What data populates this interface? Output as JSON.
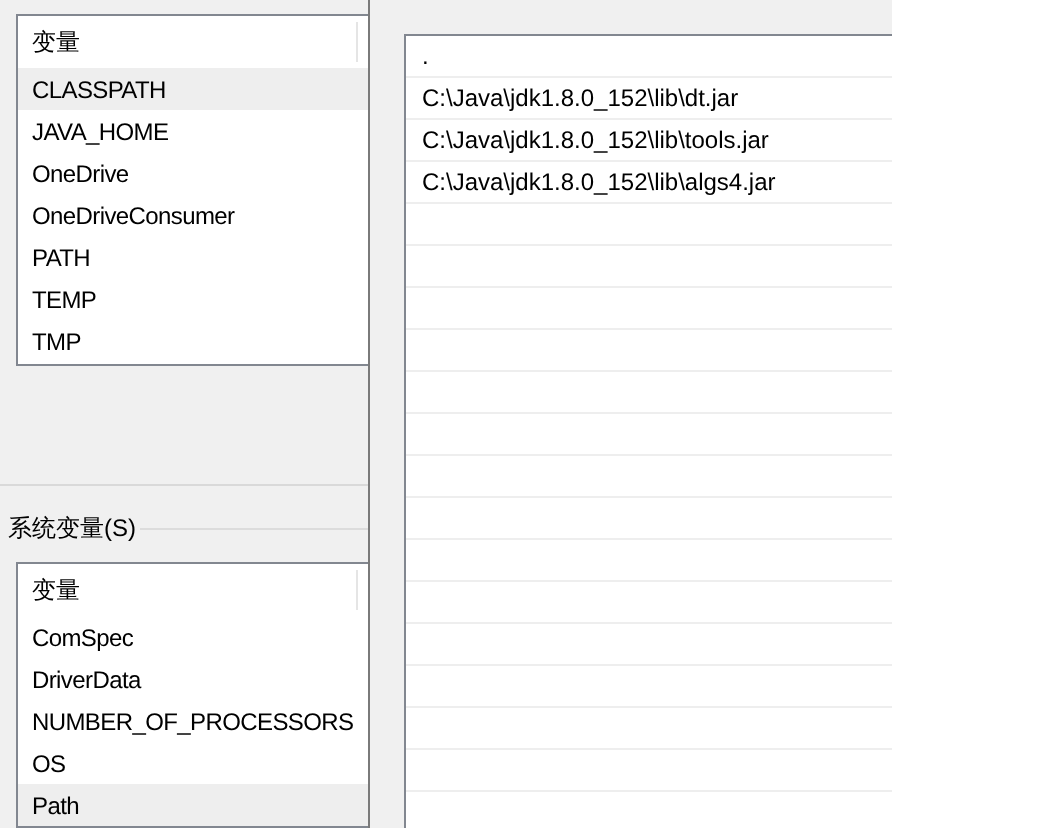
{
  "user_variables": {
    "column": "变量",
    "rows": [
      {
        "name": "CLASSPATH",
        "selected": true
      },
      {
        "name": "JAVA_HOME",
        "selected": false
      },
      {
        "name": "OneDrive",
        "selected": false
      },
      {
        "name": "OneDriveConsumer",
        "selected": false
      },
      {
        "name": "PATH",
        "selected": false
      },
      {
        "name": "TEMP",
        "selected": false
      },
      {
        "name": "TMP",
        "selected": false
      }
    ]
  },
  "system_variables": {
    "title": "系统变量(S)",
    "column": "变量",
    "rows": [
      {
        "name": "ComSpec",
        "selected": false
      },
      {
        "name": "DriverData",
        "selected": false
      },
      {
        "name": "NUMBER_OF_PROCESSORS",
        "selected": false
      },
      {
        "name": "OS",
        "selected": false
      },
      {
        "name": "Path",
        "selected": true
      }
    ]
  },
  "path_entries": [
    ".",
    "C:\\Java\\jdk1.8.0_152\\lib\\dt.jar",
    "C:\\Java\\jdk1.8.0_152\\lib\\tools.jar",
    "C:\\Java\\jdk1.8.0_152\\lib\\algs4.jar"
  ]
}
